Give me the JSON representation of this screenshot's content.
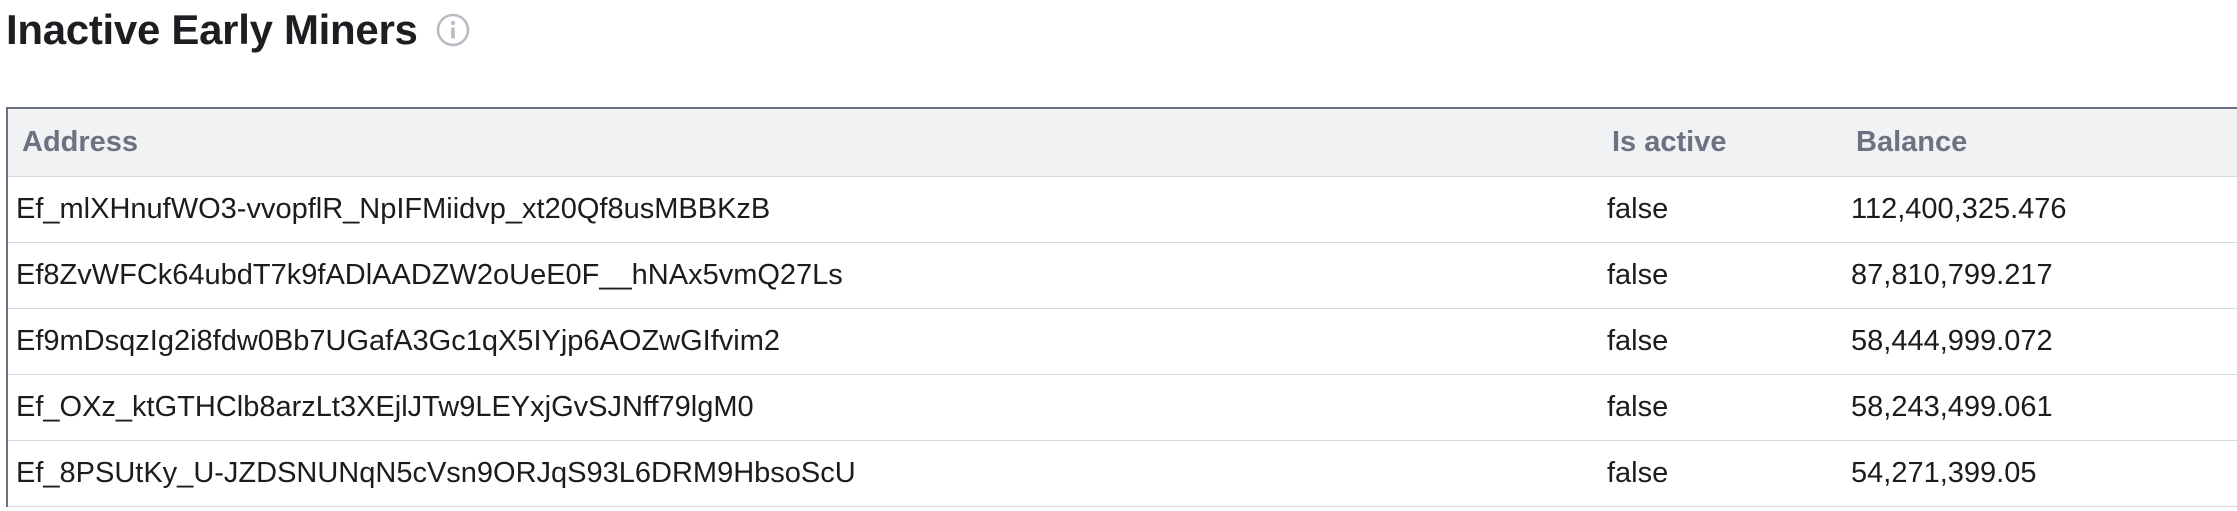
{
  "header": {
    "title": "Inactive Early Miners",
    "info_icon": "info-circle-icon"
  },
  "table": {
    "columns": {
      "address": "Address",
      "is_active": "Is active",
      "balance": "Balance"
    },
    "rows": [
      {
        "address": "Ef_mlXHnufWO3-vvopflR_NpIFMiidvp_xt20Qf8usMBBKzB",
        "is_active": "false",
        "balance": "112,400,325.476"
      },
      {
        "address": "Ef8ZvWFCk64ubdT7k9fADlAADZW2oUeE0F__hNAx5vmQ27Ls",
        "is_active": "false",
        "balance": "87,810,799.217"
      },
      {
        "address": "Ef9mDsqzIg2i8fdw0Bb7UGafA3Gc1qX5IYjp6AOZwGIfvim2",
        "is_active": "false",
        "balance": "58,444,999.072"
      },
      {
        "address": "Ef_OXz_ktGTHClb8arzLt3XEjlJTw9LEYxjGvSJNff79lgM0",
        "is_active": "false",
        "balance": "58,243,499.061"
      },
      {
        "address": "Ef_8PSUtKy_U-JZDSNUNqN5cVsn9ORJqS93L6DRM9HbsoScU",
        "is_active": "false",
        "balance": "54,271,399.05"
      }
    ]
  }
}
